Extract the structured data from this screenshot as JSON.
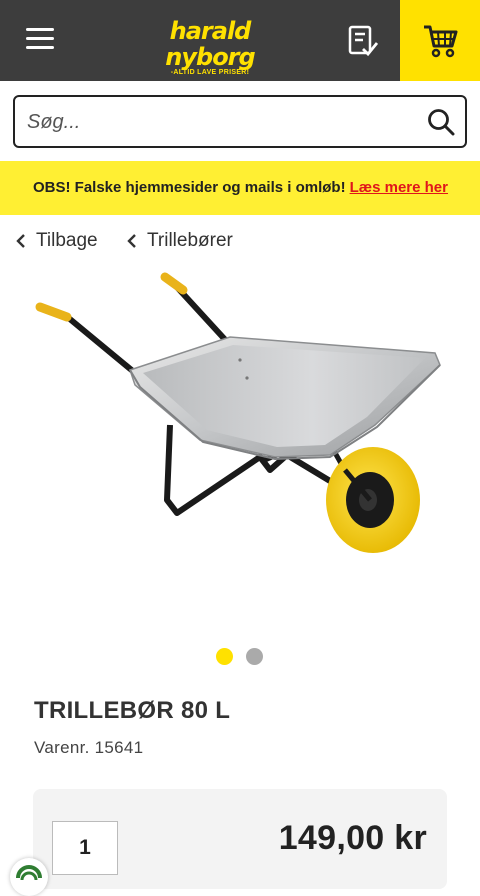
{
  "header": {
    "logo_text": "harald nyborg",
    "logo_tagline": "-ALTID LAVE PRISER!",
    "menu_icon": "hamburger-menu-icon",
    "list_icon": "checklist-icon",
    "cart_icon": "shopping-cart-icon",
    "colors": {
      "bar": "#3d3d3d",
      "accent": "#ffe100"
    }
  },
  "search": {
    "placeholder": "Søg...",
    "value": ""
  },
  "notice": {
    "text": "OBS! Falske hjemmesider og mails i omløb!",
    "link": "Læs mere her",
    "colors": {
      "background": "#ffef33",
      "link": "#e0161b"
    }
  },
  "breadcrumbs": {
    "back": "Tilbage",
    "category": "Trillebører"
  },
  "gallery": {
    "total": 2,
    "active": 1,
    "colors": {
      "active": "#ffe100",
      "inactive": "#aaaaaa"
    }
  },
  "product": {
    "title": "TRILLEBØR 80 L",
    "sku_label": "Varenr.",
    "sku": "15641",
    "quantity": "1",
    "price": "149,00 kr"
  }
}
